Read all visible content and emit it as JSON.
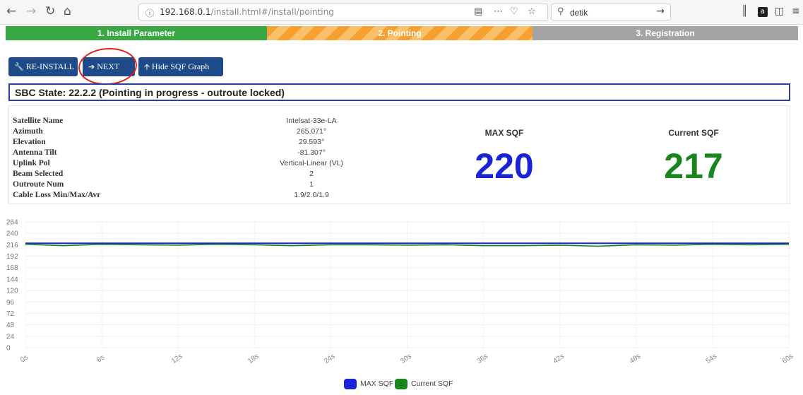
{
  "browser": {
    "url_host": "192.168.0.1",
    "url_path": "/install.html#/install/pointing",
    "search_value": "detik"
  },
  "steps": [
    {
      "label": "1. Install Parameter",
      "state": "done"
    },
    {
      "label": "2. Pointing",
      "state": "active"
    },
    {
      "label": "3. Registration",
      "state": "pending"
    }
  ],
  "buttons": {
    "reinstall": "RE-INSTALL",
    "next": "NEXT",
    "hide_graph": "Hide SQF Graph"
  },
  "state_text": "SBC State: 22.2.2 (Pointing in progress - outroute locked)",
  "info": {
    "rows": [
      {
        "label": "Satellite Name",
        "value": "Intelsat-33e-LA"
      },
      {
        "label": "Azimuth",
        "value": "265.071°"
      },
      {
        "label": "Elevation",
        "value": "29.593°"
      },
      {
        "label": "Antenna Tilt",
        "value": "-81.307°"
      },
      {
        "label": "Uplink Pol",
        "value": "Vertical-Linear (VL)"
      },
      {
        "label": "Beam Selected",
        "value": "2"
      },
      {
        "label": "Outroute Num",
        "value": "1"
      },
      {
        "label": "Cable Loss Min/Max/Avr",
        "value": "1.9/2.0/1.9"
      }
    ]
  },
  "sqf": {
    "max_label": "MAX SQF",
    "max_value": "220",
    "current_label": "Current SQF",
    "current_value": "217"
  },
  "colors": {
    "max": "#1a23d6",
    "current": "#17861c",
    "step_done": "#3aa845",
    "step_active": "#f7a030",
    "step_pending": "#a4a4a4",
    "button": "#1f4a8a"
  },
  "chart_data": {
    "type": "line",
    "x_ticks": [
      "0s",
      "6s",
      "12s",
      "18s",
      "24s",
      "30s",
      "36s",
      "42s",
      "48s",
      "54s",
      "60s"
    ],
    "y_ticks": [
      0,
      24,
      48,
      72,
      96,
      120,
      144,
      168,
      192,
      216,
      240,
      264
    ],
    "xlim": [
      0,
      60
    ],
    "ylim": [
      0,
      264
    ],
    "grid": true,
    "legend_position": "bottom",
    "series": [
      {
        "name": "MAX SQF",
        "color": "#1a23d6",
        "x": [
          0,
          6,
          12,
          18,
          24,
          30,
          36,
          42,
          48,
          54,
          60
        ],
        "y": [
          219,
          219,
          219,
          219,
          219,
          219,
          219,
          219,
          219,
          219,
          219
        ]
      },
      {
        "name": "Current SQF",
        "color": "#17861c",
        "x": [
          0,
          3,
          6,
          9,
          12,
          15,
          18,
          21,
          24,
          27,
          30,
          33,
          36,
          39,
          42,
          45,
          48,
          51,
          54,
          57,
          60
        ],
        "y": [
          217,
          214,
          217,
          216,
          215,
          217,
          216,
          214,
          216,
          216,
          215,
          216,
          214,
          214,
          215,
          213,
          216,
          215,
          217,
          216,
          217
        ]
      }
    ]
  }
}
